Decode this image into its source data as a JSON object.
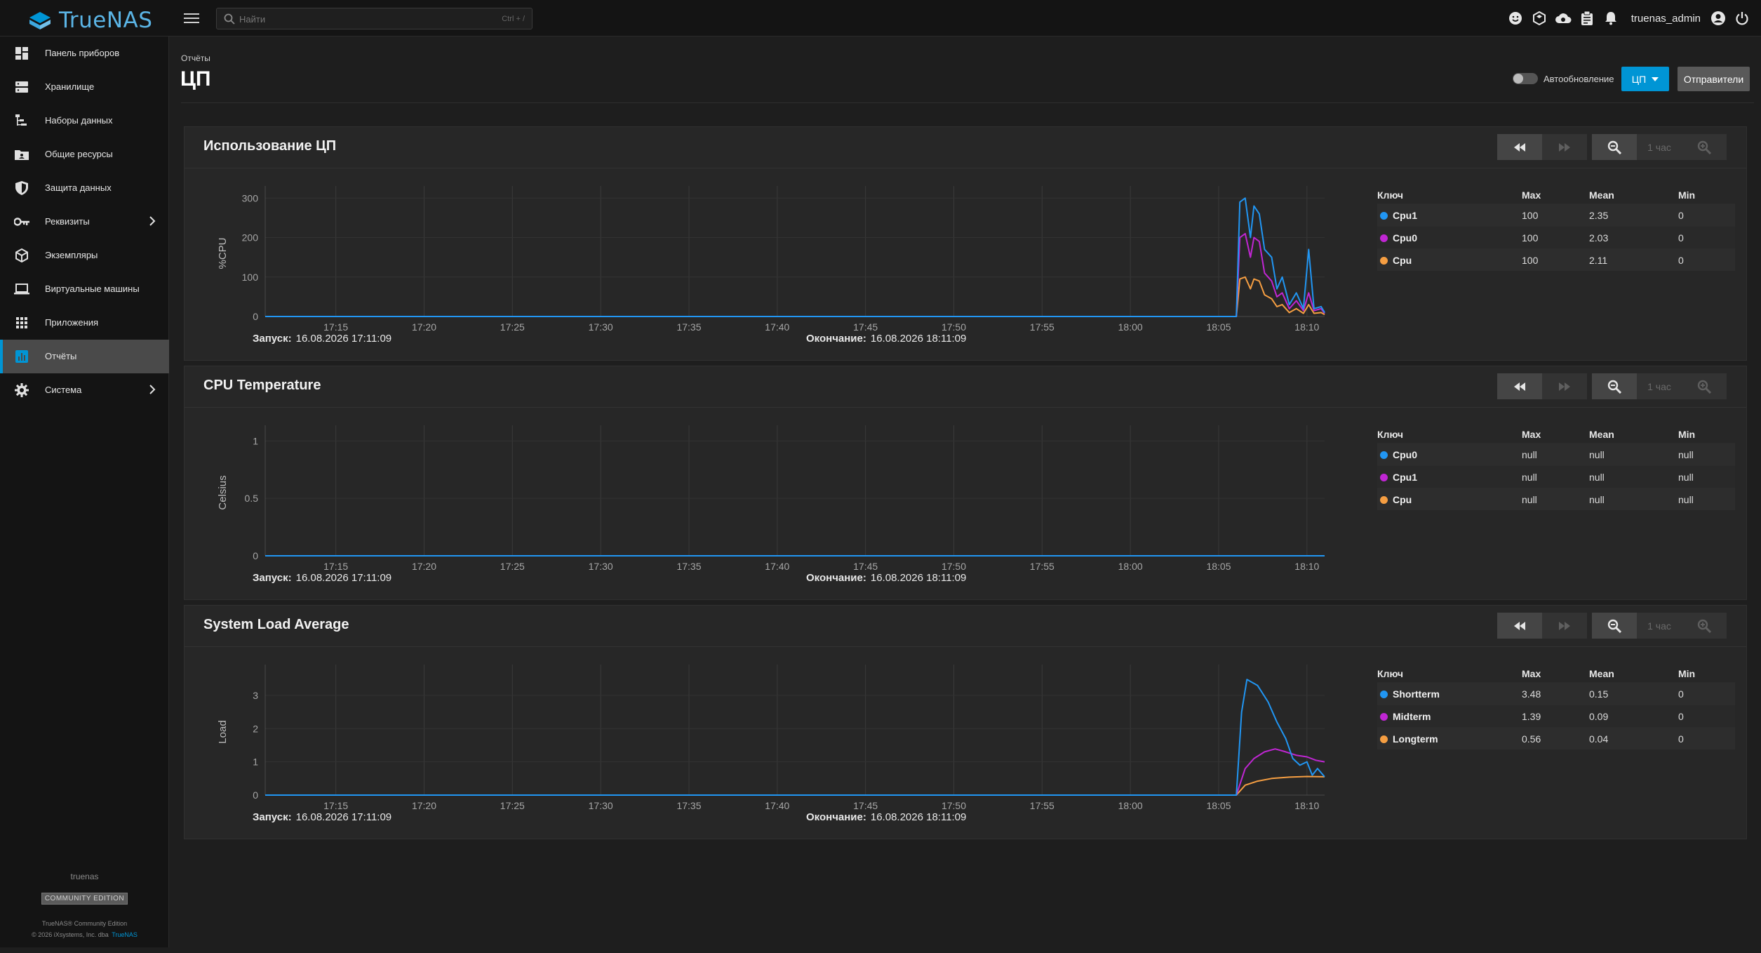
{
  "app": {
    "brand": "TrueNAS",
    "username": "truenas_admin"
  },
  "search": {
    "placeholder": "Найти",
    "shortcut": "Ctrl + /"
  },
  "sidebar": {
    "items": [
      {
        "label": "Панель приборов",
        "icon": "dashboard-icon"
      },
      {
        "label": "Хранилище",
        "icon": "storage-icon"
      },
      {
        "label": "Наборы данных",
        "icon": "datasets-icon"
      },
      {
        "label": "Общие ресурсы",
        "icon": "shares-icon"
      },
      {
        "label": "Защита данных",
        "icon": "shield-icon"
      },
      {
        "label": "Реквизиты",
        "icon": "key-icon"
      },
      {
        "label": "Экземпляры",
        "icon": "box-icon"
      },
      {
        "label": "Виртуальные машины",
        "icon": "laptop-icon"
      },
      {
        "label": "Приложения",
        "icon": "apps-grid-icon"
      },
      {
        "label": "Отчёты",
        "icon": "reports-icon"
      },
      {
        "label": "Система",
        "icon": "gear-icon"
      }
    ],
    "footer": {
      "hostname": "truenas",
      "edition": "COMMUNITY EDITION",
      "product": "TrueNAS® Community Edition",
      "copyright": "© 2026 iXsystems, Inc. dba",
      "link": "TrueNAS"
    }
  },
  "page": {
    "breadcrumb": "Отчёты",
    "title": "ЦП",
    "autorefresh_label": "Автообновление",
    "cpu_button": "ЦП",
    "exporters_button": "Отправители"
  },
  "controls": {
    "zoom_label": "1 час"
  },
  "colors": {
    "accent": "#0095d5",
    "series_blue": "#2196f3",
    "series_magenta": "#c026d3",
    "series_orange": "#f59e42"
  },
  "panels": [
    {
      "title": "Использование ЦП",
      "ylabel": "%CPU",
      "start_label": "Запуск:",
      "start": "16.08.2026 17:11:09",
      "end_label": "Окончание:",
      "end": "16.08.2026 18:11:09",
      "legend_header": {
        "key": "Ключ",
        "max": "Max",
        "mean": "Mean",
        "min": "Min"
      },
      "legend": [
        {
          "name": "Cpu1",
          "color": "#2196f3",
          "max": "100",
          "mean": "2.35",
          "min": "0"
        },
        {
          "name": "Cpu0",
          "color": "#c026d3",
          "max": "100",
          "mean": "2.03",
          "min": "0"
        },
        {
          "name": "Cpu",
          "color": "#f59e42",
          "max": "100",
          "mean": "2.11",
          "min": "0"
        }
      ]
    },
    {
      "title": "CPU Temperature",
      "ylabel": "Celsius",
      "start_label": "Запуск:",
      "start": "16.08.2026 17:11:09",
      "end_label": "Окончание:",
      "end": "16.08.2026 18:11:09",
      "legend_header": {
        "key": "Ключ",
        "max": "Max",
        "mean": "Mean",
        "min": "Min"
      },
      "legend": [
        {
          "name": "Cpu0",
          "color": "#2196f3",
          "max": "null",
          "mean": "null",
          "min": "null"
        },
        {
          "name": "Cpu1",
          "color": "#c026d3",
          "max": "null",
          "mean": "null",
          "min": "null"
        },
        {
          "name": "Cpu",
          "color": "#f59e42",
          "max": "null",
          "mean": "null",
          "min": "null"
        }
      ]
    },
    {
      "title": "System Load Average",
      "ylabel": "Load",
      "start_label": "Запуск:",
      "start": "16.08.2026 17:11:09",
      "end_label": "Окончание:",
      "end": "16.08.2026 18:11:09",
      "legend_header": {
        "key": "Ключ",
        "max": "Max",
        "mean": "Mean",
        "min": "Min"
      },
      "legend": [
        {
          "name": "Shortterm",
          "color": "#2196f3",
          "max": "3.48",
          "mean": "0.15",
          "min": "0"
        },
        {
          "name": "Midterm",
          "color": "#c026d3",
          "max": "1.39",
          "mean": "0.09",
          "min": "0"
        },
        {
          "name": "Longterm",
          "color": "#f59e42",
          "max": "0.56",
          "mean": "0.04",
          "min": "0"
        }
      ]
    }
  ],
  "chart_data": [
    {
      "type": "line",
      "ylabel": "%CPU",
      "ylim": [
        0,
        320
      ],
      "yticks": [
        0,
        100,
        200,
        300
      ],
      "xticks": [
        "17:15",
        "17:20",
        "17:25",
        "17:30",
        "17:35",
        "17:40",
        "17:45",
        "17:50",
        "17:55",
        "18:00",
        "18:05",
        "18:10"
      ],
      "x_range": [
        "17:11",
        "18:11"
      ],
      "grid": true,
      "series": [
        {
          "name": "Cpu1",
          "color": "#2196f3",
          "points": [
            [
              0,
              0
            ],
            [
              55.0,
              0
            ],
            [
              55.2,
              290
            ],
            [
              55.5,
              300
            ],
            [
              55.8,
              200
            ],
            [
              56.0,
              280
            ],
            [
              56.3,
              260
            ],
            [
              56.6,
              170
            ],
            [
              57.0,
              150
            ],
            [
              57.3,
              70
            ],
            [
              57.6,
              100
            ],
            [
              58.0,
              30
            ],
            [
              58.4,
              60
            ],
            [
              58.8,
              20
            ],
            [
              59.1,
              170
            ],
            [
              59.4,
              20
            ],
            [
              59.8,
              25
            ],
            [
              60,
              10
            ]
          ]
        },
        {
          "name": "Cpu0",
          "color": "#c026d3",
          "points": [
            [
              0,
              0
            ],
            [
              55.0,
              0
            ],
            [
              55.2,
              200
            ],
            [
              55.5,
              210
            ],
            [
              55.8,
              150
            ],
            [
              56.0,
              200
            ],
            [
              56.3,
              190
            ],
            [
              56.6,
              110
            ],
            [
              57.0,
              90
            ],
            [
              57.3,
              50
            ],
            [
              57.6,
              60
            ],
            [
              58.0,
              20
            ],
            [
              58.4,
              40
            ],
            [
              58.8,
              15
            ],
            [
              59.1,
              60
            ],
            [
              59.4,
              15
            ],
            [
              59.8,
              20
            ],
            [
              60,
              8
            ]
          ]
        },
        {
          "name": "Cpu",
          "color": "#f59e42",
          "points": [
            [
              0,
              0
            ],
            [
              55.0,
              0
            ],
            [
              55.2,
              95
            ],
            [
              55.5,
              100
            ],
            [
              55.8,
              70
            ],
            [
              56.0,
              95
            ],
            [
              56.3,
              90
            ],
            [
              56.6,
              55
            ],
            [
              57.0,
              45
            ],
            [
              57.3,
              25
            ],
            [
              57.6,
              30
            ],
            [
              58.0,
              10
            ],
            [
              58.4,
              20
            ],
            [
              58.8,
              8
            ],
            [
              59.1,
              30
            ],
            [
              59.4,
              8
            ],
            [
              59.8,
              10
            ],
            [
              60,
              5
            ]
          ]
        }
      ]
    },
    {
      "type": "line",
      "ylabel": "Celsius",
      "ylim": [
        0,
        1.1
      ],
      "yticks": [
        0,
        0.5,
        1
      ],
      "xticks": [
        "17:15",
        "17:20",
        "17:25",
        "17:30",
        "17:35",
        "17:40",
        "17:45",
        "17:50",
        "17:55",
        "18:00",
        "18:05",
        "18:10"
      ],
      "x_range": [
        "17:11",
        "18:11"
      ],
      "grid": true,
      "series": [
        {
          "name": "Cpu0",
          "color": "#2196f3",
          "points": [
            [
              0,
              0
            ],
            [
              60,
              0
            ]
          ]
        },
        {
          "name": "Cpu1",
          "color": "#c026d3",
          "points": [
            [
              0,
              0
            ],
            [
              60,
              0
            ]
          ]
        },
        {
          "name": "Cpu",
          "color": "#f59e42",
          "points": [
            [
              0,
              0
            ],
            [
              60,
              0
            ]
          ]
        }
      ]
    },
    {
      "type": "line",
      "ylabel": "Load",
      "ylim": [
        0,
        3.8
      ],
      "yticks": [
        0,
        1,
        2,
        3
      ],
      "xticks": [
        "17:15",
        "17:20",
        "17:25",
        "17:30",
        "17:35",
        "17:40",
        "17:45",
        "17:50",
        "17:55",
        "18:00",
        "18:05",
        "18:10"
      ],
      "x_range": [
        "17:11",
        "18:11"
      ],
      "grid": true,
      "series": [
        {
          "name": "Shortterm",
          "color": "#2196f3",
          "points": [
            [
              0,
              0
            ],
            [
              55.0,
              0
            ],
            [
              55.3,
              2.5
            ],
            [
              55.6,
              3.48
            ],
            [
              56.2,
              3.3
            ],
            [
              56.8,
              2.8
            ],
            [
              57.3,
              2.2
            ],
            [
              57.8,
              1.7
            ],
            [
              58.2,
              1.1
            ],
            [
              58.6,
              0.9
            ],
            [
              59.0,
              1.0
            ],
            [
              59.3,
              0.6
            ],
            [
              59.6,
              0.8
            ],
            [
              60,
              0.55
            ]
          ]
        },
        {
          "name": "Midterm",
          "color": "#c026d3",
          "points": [
            [
              0,
              0
            ],
            [
              55.0,
              0
            ],
            [
              55.5,
              0.8
            ],
            [
              56.0,
              1.1
            ],
            [
              56.6,
              1.3
            ],
            [
              57.2,
              1.39
            ],
            [
              57.8,
              1.3
            ],
            [
              58.4,
              1.2
            ],
            [
              59.0,
              1.15
            ],
            [
              59.5,
              1.05
            ],
            [
              60,
              1.0
            ]
          ]
        },
        {
          "name": "Longterm",
          "color": "#f59e42",
          "points": [
            [
              0,
              0
            ],
            [
              55.0,
              0
            ],
            [
              55.5,
              0.3
            ],
            [
              56.2,
              0.42
            ],
            [
              57.0,
              0.5
            ],
            [
              58.0,
              0.54
            ],
            [
              59.0,
              0.56
            ],
            [
              60,
              0.55
            ]
          ]
        }
      ]
    }
  ]
}
